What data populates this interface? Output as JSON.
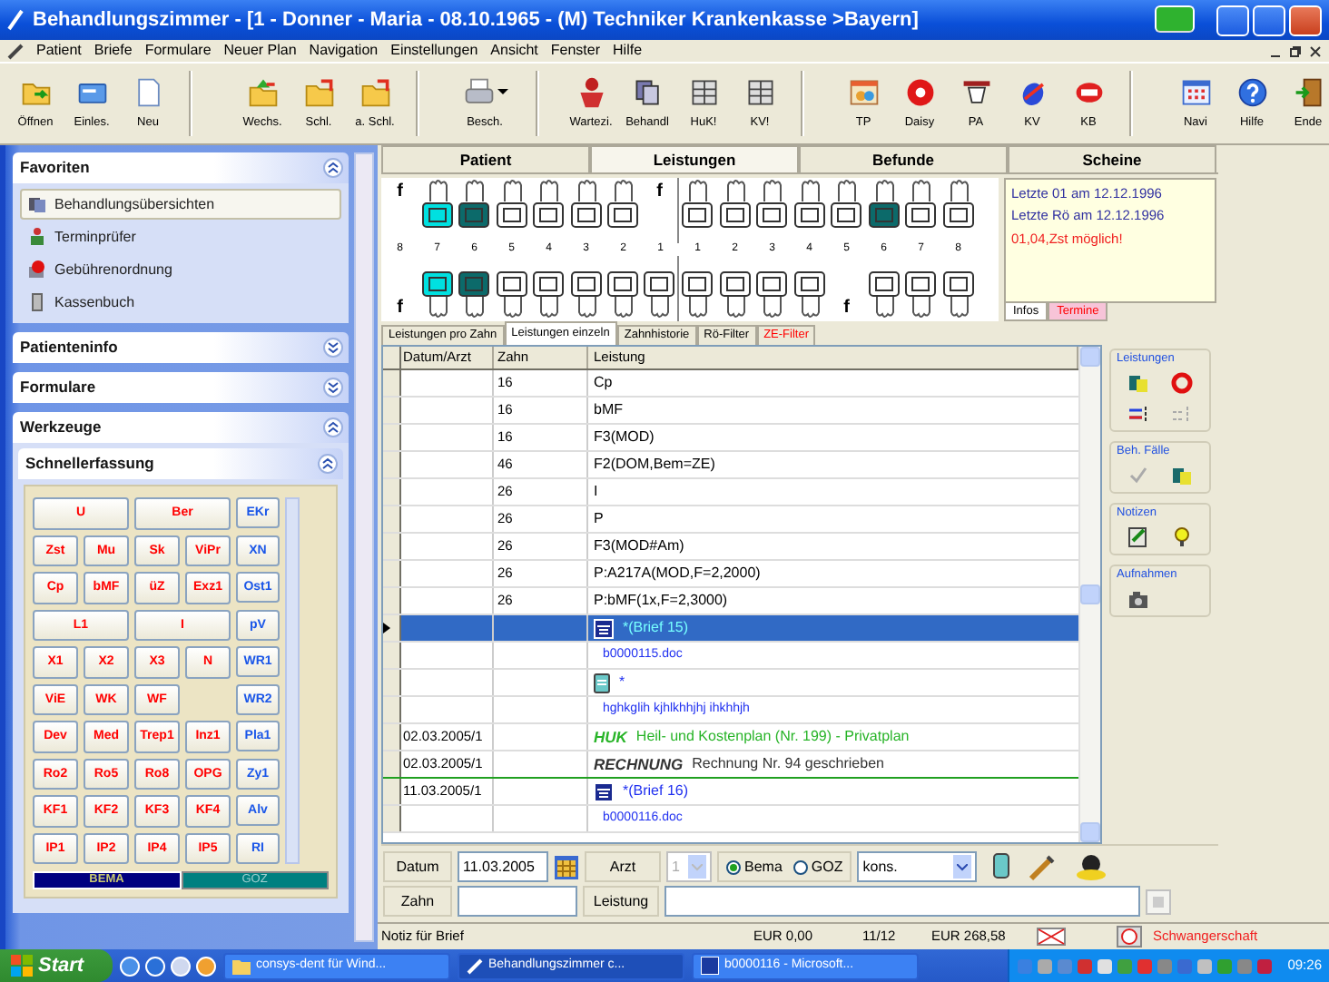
{
  "window": {
    "title": "Behandlungszimmer - [1 - Donner - Maria - 08.10.1965 - (M) Techniker Krankenkasse >Bayern]"
  },
  "menu": [
    "Patient",
    "Briefe",
    "Formulare",
    "Neuer Plan",
    "Navigation",
    "Einstellungen",
    "Ansicht",
    "Fenster",
    "Hilfe"
  ],
  "toolbar": [
    [
      {
        "label": "Öffnen",
        "kind": "button"
      },
      {
        "label": "Einles.",
        "kind": "button"
      },
      {
        "label": "Neu",
        "kind": "button"
      }
    ],
    [
      {
        "label": "Wechs.",
        "kind": "button"
      },
      {
        "label": "Schl.",
        "kind": "button"
      },
      {
        "label": "a. Schl.",
        "kind": "button"
      }
    ],
    [
      {
        "label": "Besch.",
        "kind": "split"
      }
    ],
    [
      {
        "label": "Wartezi.",
        "kind": "button"
      },
      {
        "label": "Behandl",
        "kind": "button"
      },
      {
        "label": "HuK!",
        "kind": "button"
      },
      {
        "label": "KV!",
        "kind": "button"
      }
    ],
    [
      {
        "label": "TP",
        "kind": "button"
      },
      {
        "label": "Daisy",
        "kind": "button"
      },
      {
        "label": "PA",
        "kind": "button"
      },
      {
        "label": "KV",
        "kind": "button"
      },
      {
        "label": "KB",
        "kind": "button"
      }
    ],
    [
      {
        "label": "Navi",
        "kind": "button"
      },
      {
        "label": "Hilfe",
        "kind": "button"
      },
      {
        "label": "Ende",
        "kind": "button"
      }
    ]
  ],
  "sidebar": {
    "sections": [
      {
        "title": "Favoriten",
        "expanded": true,
        "items": [
          {
            "label": "Behandlungsübersichten",
            "selected": true
          },
          {
            "label": "Terminprüfer",
            "selected": false
          },
          {
            "label": "Gebührenordnung",
            "selected": false
          },
          {
            "label": "Kassenbuch",
            "selected": false
          }
        ]
      },
      {
        "title": "Patienteninfo",
        "expanded": false
      },
      {
        "title": "Formulare",
        "expanded": false
      },
      {
        "title": "Werkzeuge",
        "expanded": true,
        "subsection": {
          "title": "Schnellerfassung",
          "expanded": true
        }
      }
    ],
    "quick_entry": {
      "rows": [
        [
          "U",
          "Ber"
        ],
        [
          "Zst",
          "Mu",
          "Sk",
          "ViPr"
        ],
        [
          "Cp",
          "bMF",
          "üZ",
          "Exz1"
        ],
        [
          "L1",
          "I"
        ],
        [
          "X1",
          "X2",
          "X3",
          "N"
        ],
        [
          "ViE",
          "WK",
          "WF"
        ],
        [
          "Dev",
          "Med",
          "Trep1",
          "Inz1"
        ],
        [
          "Ro2",
          "Ro5",
          "Ro8",
          "OPG"
        ],
        [
          "KF1",
          "KF2",
          "KF3",
          "KF4"
        ],
        [
          "IP1",
          "IP2",
          "IP4",
          "IP5"
        ]
      ],
      "side": [
        "EKr",
        "XN",
        "Ost1",
        "pV",
        "WR1",
        "WR2",
        "Pla1",
        "Zy1",
        "Alv",
        "RI"
      ],
      "tabs": [
        {
          "label": "BEMA",
          "selected": true
        },
        {
          "label": "GOZ",
          "selected": false
        }
      ]
    }
  },
  "tabs": [
    {
      "label": "Patient",
      "selected": false
    },
    {
      "label": "Leistungen",
      "selected": true
    },
    {
      "label": "Befunde",
      "selected": false
    },
    {
      "label": "Scheine",
      "selected": false
    }
  ],
  "tooth_chart": {
    "upper": [
      {
        "kind": "missing",
        "label": "f"
      },
      {
        "kind": "tooth",
        "color": "#00e0e0"
      },
      {
        "kind": "tooth",
        "color": "#0c6a6a"
      },
      {
        "kind": "tooth",
        "color": "#ffffff"
      },
      {
        "kind": "tooth",
        "color": "#ffffff"
      },
      {
        "kind": "tooth",
        "color": "#ffffff"
      },
      {
        "kind": "tooth",
        "color": "#ffffff"
      },
      {
        "kind": "missing",
        "label": "f"
      },
      {
        "kind": "tooth",
        "color": "#ffffff"
      },
      {
        "kind": "tooth",
        "color": "#ffffff"
      },
      {
        "kind": "tooth",
        "color": "#ffffff"
      },
      {
        "kind": "tooth",
        "color": "#ffffff"
      },
      {
        "kind": "tooth",
        "color": "#ffffff"
      },
      {
        "kind": "tooth",
        "color": "#0c6a6a"
      },
      {
        "kind": "tooth",
        "color": "#ffffff"
      },
      {
        "kind": "tooth",
        "color": "#ffffff"
      }
    ],
    "numbers": [
      "8",
      "7",
      "6",
      "5",
      "4",
      "3",
      "2",
      "1",
      "1",
      "2",
      "3",
      "4",
      "5",
      "6",
      "7",
      "8"
    ],
    "lower": [
      {
        "kind": "missing",
        "label": "f"
      },
      {
        "kind": "tooth",
        "color": "#00e0e0"
      },
      {
        "kind": "tooth",
        "color": "#0c6a6a"
      },
      {
        "kind": "tooth",
        "color": "#ffffff"
      },
      {
        "kind": "tooth",
        "color": "#ffffff"
      },
      {
        "kind": "tooth",
        "color": "#ffffff"
      },
      {
        "kind": "tooth",
        "color": "#ffffff"
      },
      {
        "kind": "tooth",
        "color": "#ffffff"
      },
      {
        "kind": "tooth",
        "color": "#ffffff"
      },
      {
        "kind": "tooth",
        "color": "#ffffff"
      },
      {
        "kind": "tooth",
        "color": "#ffffff"
      },
      {
        "kind": "tooth",
        "color": "#ffffff"
      },
      {
        "kind": "missing",
        "label": "f"
      },
      {
        "kind": "tooth",
        "color": "#ffffff"
      },
      {
        "kind": "tooth",
        "color": "#ffffff"
      },
      {
        "kind": "tooth",
        "color": "#ffffff"
      }
    ]
  },
  "info": {
    "lines": [
      {
        "text": "Letzte 01  am 12.12.1996",
        "kind": "info"
      },
      {
        "text": "Letzte Rö  am 12.12.1996",
        "kind": "info"
      },
      {
        "text": "01,04,Zst möglich!",
        "kind": "warning"
      }
    ],
    "tabs": [
      {
        "label": "Infos",
        "selected": true
      },
      {
        "label": "Termine",
        "selected": false
      }
    ]
  },
  "subtabs": [
    {
      "label": "Leistungen pro Zahn",
      "selected": false,
      "kind": "normal"
    },
    {
      "label": "Leistungen einzeln",
      "selected": true,
      "kind": "normal"
    },
    {
      "label": "Zahnhistorie",
      "selected": false,
      "kind": "normal"
    },
    {
      "label": "Rö-Filter",
      "selected": false,
      "kind": "normal"
    },
    {
      "label": "ZE-Filter",
      "selected": false,
      "kind": "alert"
    }
  ],
  "table": {
    "columns": [
      "Datum/Arzt",
      "Zahn",
      "Leistung"
    ],
    "rows": [
      {
        "kind": "entry",
        "date": "",
        "tooth": "16",
        "text": "Cp",
        "selected": false
      },
      {
        "kind": "entry",
        "date": "",
        "tooth": "16",
        "text": "bMF",
        "selected": false
      },
      {
        "kind": "entry",
        "date": "",
        "tooth": "16",
        "text": "F3(MOD)",
        "selected": false
      },
      {
        "kind": "entry",
        "date": "",
        "tooth": "46",
        "text": "F2(DOM,Bem=ZE)",
        "selected": false
      },
      {
        "kind": "entry",
        "date": "",
        "tooth": "26",
        "text": "I",
        "selected": false
      },
      {
        "kind": "entry",
        "date": "",
        "tooth": "26",
        "text": "P",
        "selected": false
      },
      {
        "kind": "entry",
        "date": "",
        "tooth": "26",
        "text": "F3(MOD#Am)",
        "selected": false
      },
      {
        "kind": "entry",
        "date": "",
        "tooth": "26",
        "text": "P:A217A(MOD,F=2,2000)",
        "selected": false
      },
      {
        "kind": "entry",
        "date": "",
        "tooth": "26",
        "text": "P:bMF(1x,F=2,3000)",
        "selected": false
      },
      {
        "kind": "letter",
        "date": "",
        "tooth": "",
        "text": "*(Brief 15)",
        "selected": true
      },
      {
        "kind": "file",
        "date": "",
        "tooth": "",
        "text": "b0000115.doc",
        "selected": false
      },
      {
        "kind": "note",
        "date": "",
        "tooth": "",
        "text": "*",
        "selected": false
      },
      {
        "kind": "file",
        "date": "",
        "tooth": "",
        "text": "hghkglih kjhlkhhjhj ihkhhjh",
        "selected": false
      },
      {
        "kind": "plan",
        "date": "02.03.2005/1",
        "tooth": "",
        "tag": "HUK",
        "text": "Heil- und Kostenplan (Nr. 199) - Privatplan",
        "selected": false
      },
      {
        "kind": "invoice",
        "date": "02.03.2005/1",
        "tooth": "",
        "tag": "RECHNUNG",
        "text": "Rechnung Nr. 94 geschrieben",
        "selected": false
      },
      {
        "kind": "letter",
        "date": "11.03.2005/1",
        "tooth": "",
        "text": "*(Brief 16)",
        "selected": false
      },
      {
        "kind": "file",
        "date": "",
        "tooth": "",
        "text": "b0000116.doc",
        "selected": false
      }
    ]
  },
  "tool_groups": [
    "Leistungen",
    "Beh. Fälle",
    "Notizen",
    "Aufnahmen"
  ],
  "entry": {
    "date_button": "Datum",
    "date": "11.03.2005",
    "doctor_button": "Arzt",
    "doctor": "1",
    "doctor_disabled": true,
    "radios": [
      {
        "label": "Bema",
        "selected": true
      },
      {
        "label": "GOZ",
        "selected": false
      }
    ],
    "mode": "kons.",
    "tooth_button": "Zahn",
    "service_button": "Leistung"
  },
  "status_bar": {
    "note": "Notiz für Brief",
    "amount_1": "EUR 0,00",
    "count": "11/12",
    "amount_2": "EUR 268,58",
    "alert": "Schwangerschaft"
  },
  "taskbar": {
    "start": "Start",
    "tasks": [
      {
        "label": "consys-dent für Wind...",
        "selected": false
      },
      {
        "label": "Behandlungszimmer c...",
        "selected": true
      },
      {
        "label": "b0000116 - Microsoft...",
        "selected": false
      }
    ],
    "clock": "09:26"
  }
}
